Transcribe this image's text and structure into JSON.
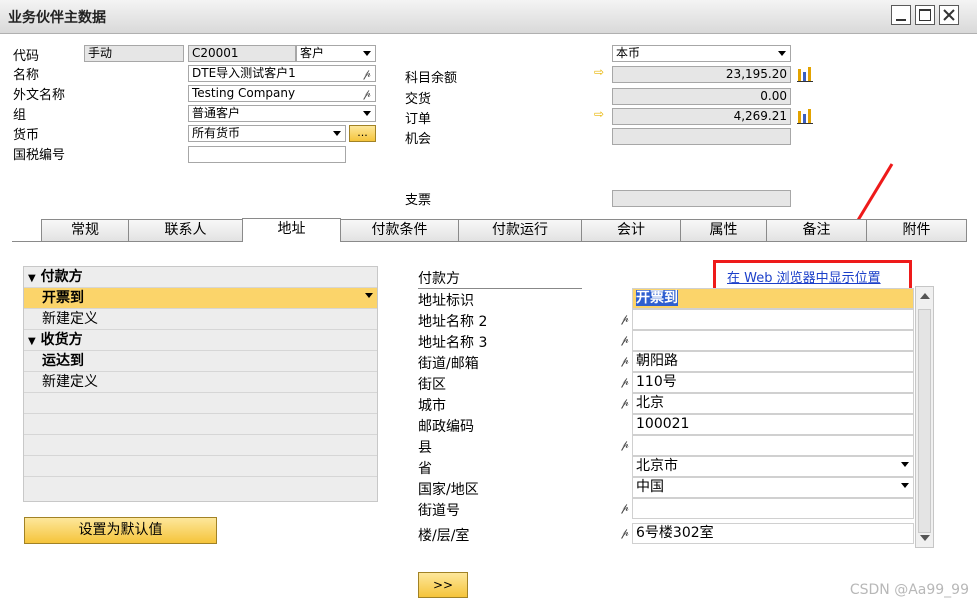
{
  "window": {
    "title": "业务伙伴主数据"
  },
  "header": {
    "code_label": "代码",
    "code_mode": "手动",
    "code_value": "C20001",
    "type_value": "客户",
    "name_label": "名称",
    "name_value": "DTE导入测试客户1",
    "foreign_name_label": "外文名称",
    "foreign_name_value": "Testing Company",
    "group_label": "组",
    "group_value": "普通客户",
    "currency_label": "货币",
    "currency_value": "所有货币",
    "currency_btn": "...",
    "tax_label": "国税编号",
    "tax_value": ""
  },
  "balances": {
    "currency_select": "本币",
    "account_balance_label": "科目余额",
    "account_balance_value": "23,195.20",
    "delivery_label": "交货",
    "delivery_value": "0.00",
    "order_label": "订单",
    "order_value": "4,269.21",
    "opportunity_label": "机会",
    "opportunity_value": "",
    "check_label": "支票",
    "check_value": ""
  },
  "tabs": [
    {
      "label": "常规"
    },
    {
      "label": "联系人"
    },
    {
      "label": "地址"
    },
    {
      "label": "付款条件"
    },
    {
      "label": "付款运行"
    },
    {
      "label": "会计"
    },
    {
      "label": "属性"
    },
    {
      "label": "备注"
    },
    {
      "label": "附件"
    }
  ],
  "address_list": {
    "items": [
      {
        "label": "付款方"
      },
      {
        "label": "开票到"
      },
      {
        "label": "新建定义"
      },
      {
        "label": "收货方"
      },
      {
        "label": "运达到"
      },
      {
        "label": "新建定义"
      }
    ],
    "set_default_button": "设置为默认值"
  },
  "detail": {
    "section_title": "付款方",
    "web_link": "在 Web 浏览器中显示位置",
    "rows": [
      {
        "label": "地址标识",
        "value": "开票到"
      },
      {
        "label": "地址名称 2",
        "value": ""
      },
      {
        "label": "地址名称 3",
        "value": ""
      },
      {
        "label": "街道/邮箱",
        "value": "朝阳路"
      },
      {
        "label": "街区",
        "value": "110号"
      },
      {
        "label": "城市",
        "value": "北京"
      },
      {
        "label": "邮政编码",
        "value": "100021"
      },
      {
        "label": "县",
        "value": ""
      },
      {
        "label": "省",
        "value": "北京市"
      },
      {
        "label": "国家/地区",
        "value": "中国"
      },
      {
        "label": "街道号",
        "value": ""
      },
      {
        "label": "楼/层/室",
        "value": "6号楼302室"
      }
    ],
    "next_button": ">>"
  },
  "watermark": "CSDN @Aa99_99",
  "colors": {
    "selected": "#fbd46a",
    "highlight_box": "#ee1a1a",
    "link": "#1b3fc9"
  }
}
